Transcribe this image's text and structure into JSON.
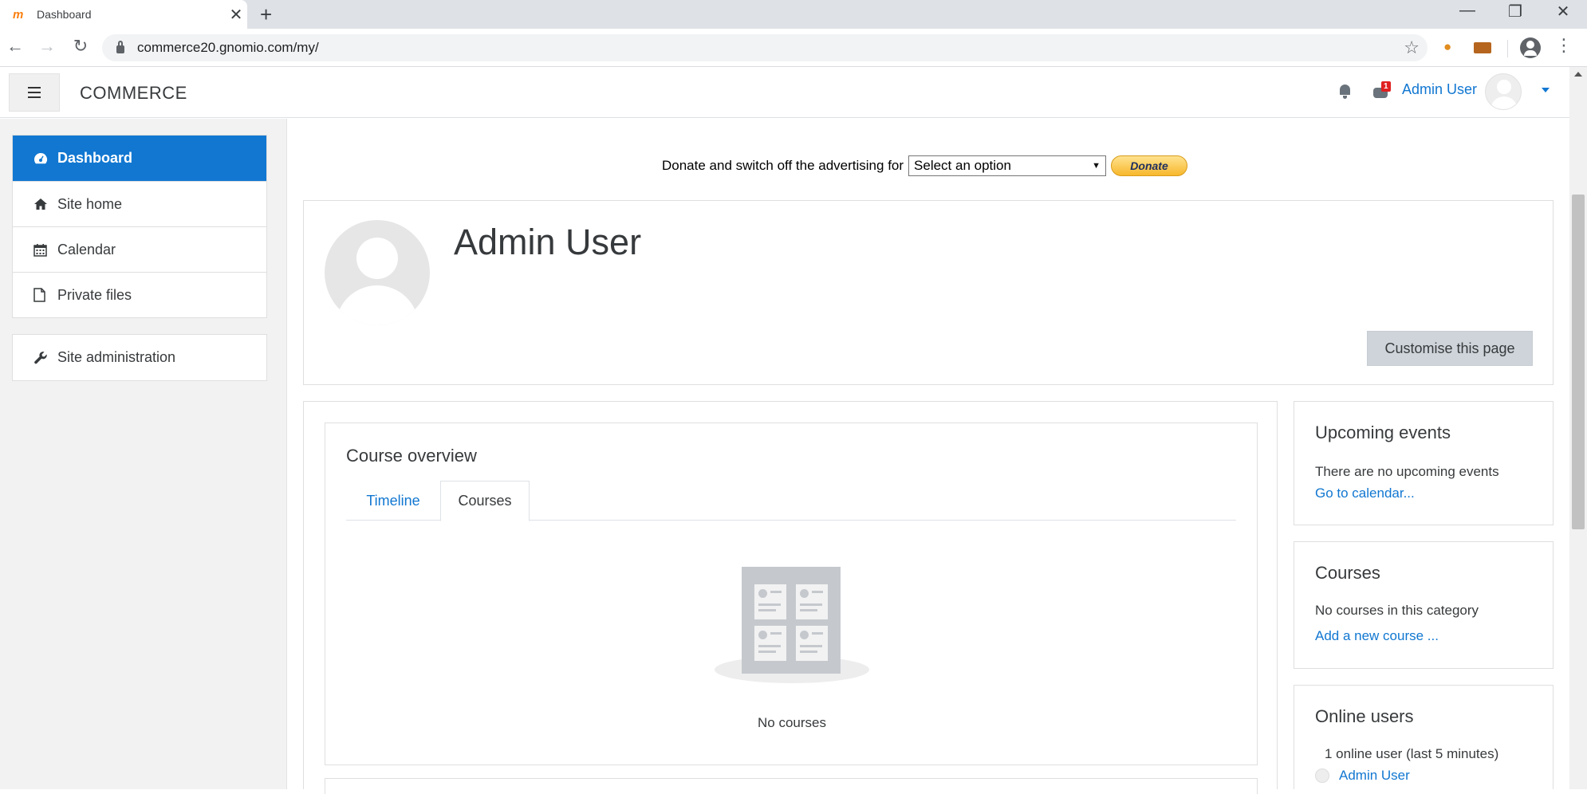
{
  "browser": {
    "tab_title": "Dashboard",
    "tab_favicon": "moodle-logo",
    "url": "commerce20.gnomio.com/my/"
  },
  "navbar": {
    "brand": "COMMERCE",
    "message_badge": "1",
    "user_name": "Admin User"
  },
  "drawer": {
    "items": [
      {
        "label": "Dashboard",
        "icon": "dashboard-icon",
        "active": true
      },
      {
        "label": "Site home",
        "icon": "home-icon"
      },
      {
        "label": "Calendar",
        "icon": "calendar-icon"
      },
      {
        "label": "Private files",
        "icon": "file-icon"
      }
    ],
    "admin": {
      "label": "Site administration",
      "icon": "wrench-icon"
    }
  },
  "donate": {
    "text": "Donate and switch off the advertising for",
    "select_value": "Select an option",
    "button_label": "Donate"
  },
  "header": {
    "title": "Admin User",
    "customise_label": "Customise this page"
  },
  "course_overview": {
    "title": "Course overview",
    "tabs": [
      "Timeline",
      "Courses"
    ],
    "active_tab": "Courses",
    "empty_text": "No courses"
  },
  "blocks": {
    "upcoming": {
      "title": "Upcoming events",
      "text": "There are no upcoming events",
      "link": "Go to calendar..."
    },
    "courses": {
      "title": "Courses",
      "text": "No courses in this category",
      "link": "Add a new course ..."
    },
    "online": {
      "title": "Online users",
      "text": "1 online user (last 5 minutes)",
      "user": "Admin User"
    }
  },
  "colors": {
    "accent": "#1177d1",
    "drawer_bg": "#f2f2f2",
    "badge": "#e02020"
  }
}
